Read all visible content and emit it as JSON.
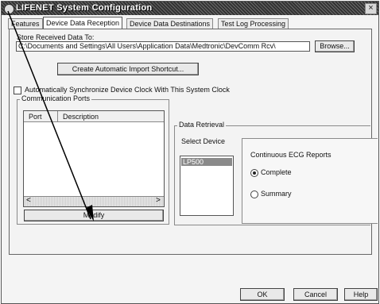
{
  "window": {
    "title": "LIFENET System Configuration",
    "close_glyph": "×"
  },
  "tabs": [
    {
      "label": "Features"
    },
    {
      "label": "Device Data Reception"
    },
    {
      "label": "Device Data Destinations"
    },
    {
      "label": "Test Log Processing"
    }
  ],
  "store": {
    "label": "Store Received Data To:",
    "path_value": "C:\\Documents and Settings\\All Users\\Application Data\\Medtronic\\DevComm Rcv\\",
    "browse_label": "Browse..."
  },
  "shortcut_button": "Create Automatic Import Shortcut...",
  "sync_checkbox": {
    "label": "Automatically Synchronize Device Clock With This System Clock",
    "checked": false
  },
  "comm_ports": {
    "title": "Communication Ports",
    "columns": [
      "Port",
      "Description"
    ],
    "scroll_left": "<",
    "scroll_right": ">",
    "modify_label": "Modify"
  },
  "data_retrieval": {
    "title": "Data Retrieval",
    "select_label": "Select Device",
    "devices": [
      "LP500"
    ],
    "report_title": "Continuous ECG Reports",
    "options": [
      {
        "label": "Complete",
        "selected": true
      },
      {
        "label": "Summary",
        "selected": false
      }
    ]
  },
  "footer": {
    "ok": "OK",
    "cancel": "Cancel",
    "help": "Help"
  },
  "colors": {
    "titlebar": "#3c3c3c",
    "selection": "#8a8a8a"
  }
}
